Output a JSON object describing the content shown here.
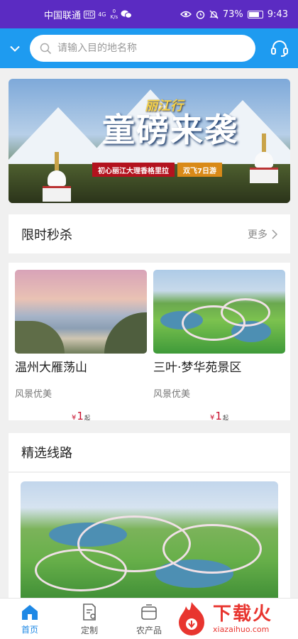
{
  "status_bar": {
    "carrier": "中国联通",
    "hd_badge": "HD",
    "signal_type": "4G",
    "speed_value": "0",
    "speed_unit": "K/s",
    "battery": "73%",
    "time": "9:43"
  },
  "header": {
    "search_placeholder": "请输入目的地名称",
    "accent_color": "#1e9bf0"
  },
  "banner": {
    "title": "童磅来袭",
    "subtitle": "丽江行",
    "caption_left": "初心丽江大理香格里拉",
    "caption_right": "双飞7日游"
  },
  "flash_sale": {
    "title": "限时秒杀",
    "more_label": "更多",
    "items": [
      {
        "name": "温州大雁荡山",
        "tag": "风景优美",
        "currency": "¥",
        "price": "1",
        "unit": "起"
      },
      {
        "name": "三叶·梦华苑景区",
        "tag": "风景优美",
        "currency": "¥",
        "price": "1",
        "unit": "起"
      }
    ]
  },
  "featured_routes": {
    "title": "精选线路"
  },
  "tab_bar": {
    "items": [
      {
        "label": "首页",
        "icon": "home-icon",
        "active": true
      },
      {
        "label": "定制",
        "icon": "custom-doc-icon",
        "active": false
      },
      {
        "label": "农产品",
        "icon": "produce-icon",
        "active": false
      }
    ]
  },
  "watermark": {
    "main": "下载火",
    "url": "xiazaihuo.com"
  }
}
